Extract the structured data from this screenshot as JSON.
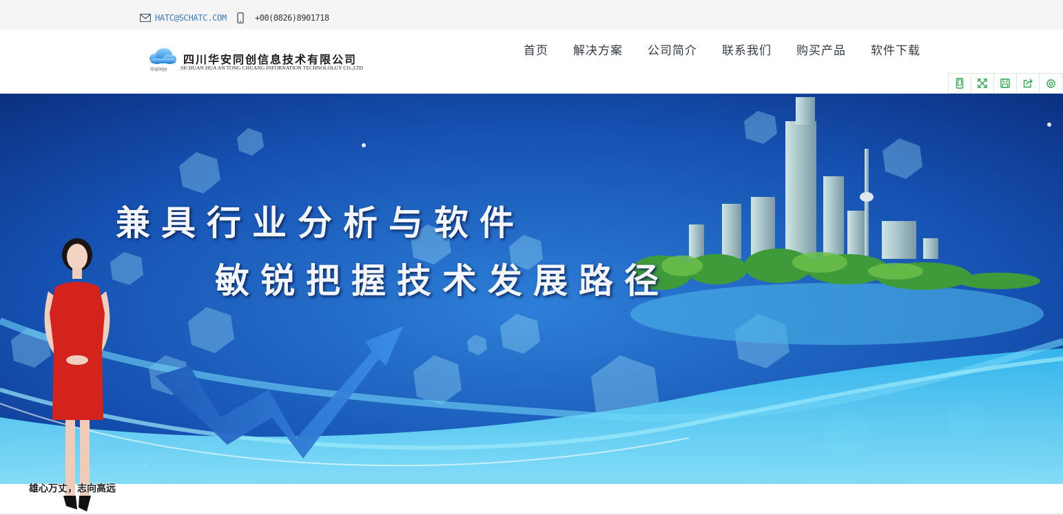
{
  "topbar": {
    "email": "HATC@SCHATC.COM",
    "phone": "+00(0826)8901718",
    "email_icon": "envelope-icon",
    "phone_icon": "mobile-phone-icon"
  },
  "logo": {
    "company_cn": "四川华安同创信息技术有限公司",
    "company_en": "SICHUAN HUA AN TONG CHUANG INFORNATION TECHNOLOLGY CO.,LTD",
    "tagline": "华安同创"
  },
  "nav": {
    "items": [
      {
        "label": "首页"
      },
      {
        "label": "解决方案"
      },
      {
        "label": "公司简介"
      },
      {
        "label": "联系我们"
      },
      {
        "label": "购买产品"
      },
      {
        "label": "软件下载"
      }
    ]
  },
  "toolbar": {
    "icons": [
      "mobile-view-icon",
      "fullscreen-icon",
      "save-icon",
      "share-icon",
      "settings-icon"
    ],
    "accent": "#2aa84a"
  },
  "banner": {
    "line1": "兼具行业分析与软件",
    "line2": "敏锐把握技术发展路径",
    "presenter_caption": "雄心万丈，志向高远"
  },
  "colors": {
    "banner_dark": "#0a2a78",
    "banner_light": "#2a9fe0",
    "email_link": "#3c78c8"
  }
}
